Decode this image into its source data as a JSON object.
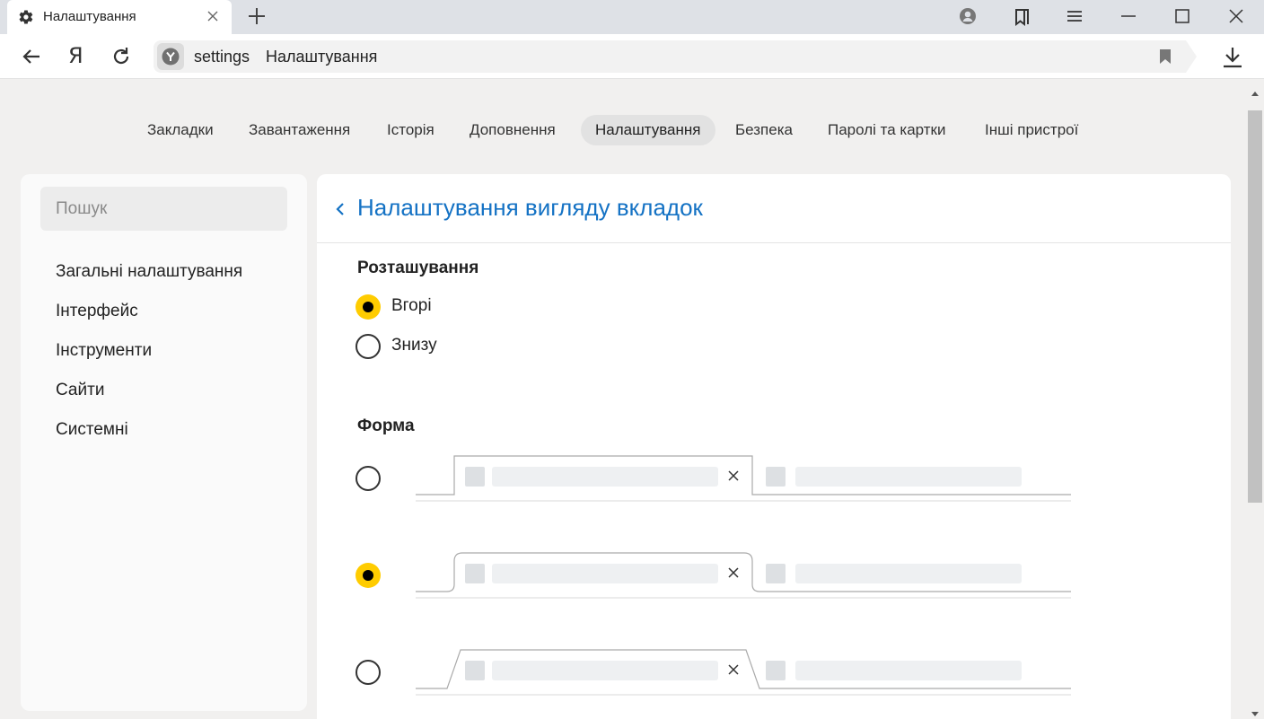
{
  "window": {
    "tab_title": "Налаштування",
    "tab_icon": "gear-icon",
    "controls": [
      "profile-icon",
      "bookmarks-collections-icon",
      "menu-icon",
      "minimize-icon",
      "maximize-icon",
      "close-icon"
    ]
  },
  "address_bar": {
    "logo": "Я",
    "url_scheme": "settings",
    "page_title": "Налаштування"
  },
  "top_nav": {
    "items": [
      "Закладки",
      "Завантаження",
      "Історія",
      "Доповнення",
      "Налаштування",
      "Безпека",
      "Паролі та картки",
      "Інші пристрої"
    ],
    "active": "Налаштування"
  },
  "sidebar": {
    "search_placeholder": "Пошук",
    "items": [
      "Загальні налаштування",
      "Інтерфейс",
      "Інструменти",
      "Сайти",
      "Системні"
    ]
  },
  "panel": {
    "title": "Налаштування вигляду вкладок",
    "position": {
      "label": "Розташування",
      "options": [
        "Вгорі",
        "Знизу"
      ],
      "selected": "Вгорі"
    },
    "shape": {
      "label": "Форма",
      "options": [
        "rectangular",
        "rounded",
        "trapezoid"
      ],
      "selected": "rounded"
    }
  },
  "colors": {
    "accent": "#ffcc00",
    "link": "#1472c4",
    "page_background": "#f1f0ef",
    "titlebar": "#dee1e6"
  }
}
